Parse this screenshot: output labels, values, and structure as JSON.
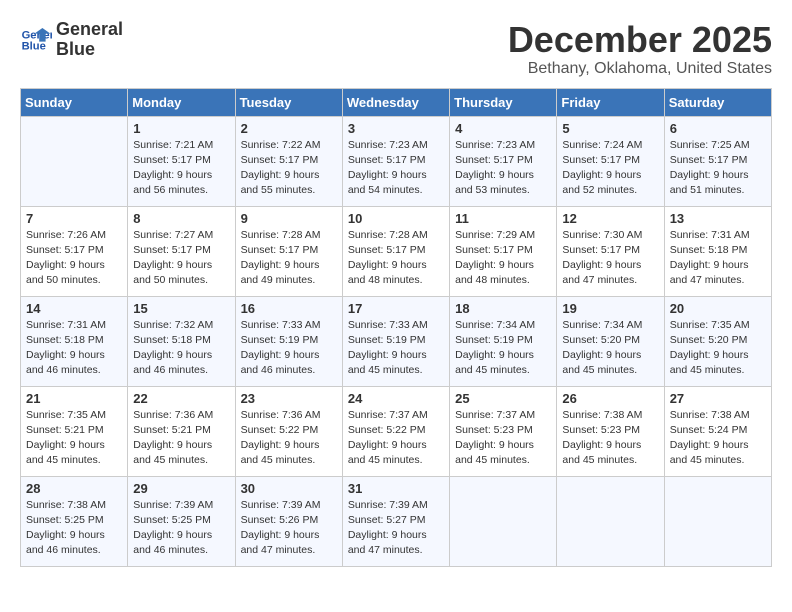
{
  "logo": {
    "line1": "General",
    "line2": "Blue"
  },
  "title": "December 2025",
  "location": "Bethany, Oklahoma, United States",
  "days_of_week": [
    "Sunday",
    "Monday",
    "Tuesday",
    "Wednesday",
    "Thursday",
    "Friday",
    "Saturday"
  ],
  "weeks": [
    [
      {
        "day": "",
        "info": ""
      },
      {
        "day": "1",
        "info": "Sunrise: 7:21 AM\nSunset: 5:17 PM\nDaylight: 9 hours\nand 56 minutes."
      },
      {
        "day": "2",
        "info": "Sunrise: 7:22 AM\nSunset: 5:17 PM\nDaylight: 9 hours\nand 55 minutes."
      },
      {
        "day": "3",
        "info": "Sunrise: 7:23 AM\nSunset: 5:17 PM\nDaylight: 9 hours\nand 54 minutes."
      },
      {
        "day": "4",
        "info": "Sunrise: 7:23 AM\nSunset: 5:17 PM\nDaylight: 9 hours\nand 53 minutes."
      },
      {
        "day": "5",
        "info": "Sunrise: 7:24 AM\nSunset: 5:17 PM\nDaylight: 9 hours\nand 52 minutes."
      },
      {
        "day": "6",
        "info": "Sunrise: 7:25 AM\nSunset: 5:17 PM\nDaylight: 9 hours\nand 51 minutes."
      }
    ],
    [
      {
        "day": "7",
        "info": "Sunrise: 7:26 AM\nSunset: 5:17 PM\nDaylight: 9 hours\nand 50 minutes."
      },
      {
        "day": "8",
        "info": "Sunrise: 7:27 AM\nSunset: 5:17 PM\nDaylight: 9 hours\nand 50 minutes."
      },
      {
        "day": "9",
        "info": "Sunrise: 7:28 AM\nSunset: 5:17 PM\nDaylight: 9 hours\nand 49 minutes."
      },
      {
        "day": "10",
        "info": "Sunrise: 7:28 AM\nSunset: 5:17 PM\nDaylight: 9 hours\nand 48 minutes."
      },
      {
        "day": "11",
        "info": "Sunrise: 7:29 AM\nSunset: 5:17 PM\nDaylight: 9 hours\nand 48 minutes."
      },
      {
        "day": "12",
        "info": "Sunrise: 7:30 AM\nSunset: 5:17 PM\nDaylight: 9 hours\nand 47 minutes."
      },
      {
        "day": "13",
        "info": "Sunrise: 7:31 AM\nSunset: 5:18 PM\nDaylight: 9 hours\nand 47 minutes."
      }
    ],
    [
      {
        "day": "14",
        "info": "Sunrise: 7:31 AM\nSunset: 5:18 PM\nDaylight: 9 hours\nand 46 minutes."
      },
      {
        "day": "15",
        "info": "Sunrise: 7:32 AM\nSunset: 5:18 PM\nDaylight: 9 hours\nand 46 minutes."
      },
      {
        "day": "16",
        "info": "Sunrise: 7:33 AM\nSunset: 5:19 PM\nDaylight: 9 hours\nand 46 minutes."
      },
      {
        "day": "17",
        "info": "Sunrise: 7:33 AM\nSunset: 5:19 PM\nDaylight: 9 hours\nand 45 minutes."
      },
      {
        "day": "18",
        "info": "Sunrise: 7:34 AM\nSunset: 5:19 PM\nDaylight: 9 hours\nand 45 minutes."
      },
      {
        "day": "19",
        "info": "Sunrise: 7:34 AM\nSunset: 5:20 PM\nDaylight: 9 hours\nand 45 minutes."
      },
      {
        "day": "20",
        "info": "Sunrise: 7:35 AM\nSunset: 5:20 PM\nDaylight: 9 hours\nand 45 minutes."
      }
    ],
    [
      {
        "day": "21",
        "info": "Sunrise: 7:35 AM\nSunset: 5:21 PM\nDaylight: 9 hours\nand 45 minutes."
      },
      {
        "day": "22",
        "info": "Sunrise: 7:36 AM\nSunset: 5:21 PM\nDaylight: 9 hours\nand 45 minutes."
      },
      {
        "day": "23",
        "info": "Sunrise: 7:36 AM\nSunset: 5:22 PM\nDaylight: 9 hours\nand 45 minutes."
      },
      {
        "day": "24",
        "info": "Sunrise: 7:37 AM\nSunset: 5:22 PM\nDaylight: 9 hours\nand 45 minutes."
      },
      {
        "day": "25",
        "info": "Sunrise: 7:37 AM\nSunset: 5:23 PM\nDaylight: 9 hours\nand 45 minutes."
      },
      {
        "day": "26",
        "info": "Sunrise: 7:38 AM\nSunset: 5:23 PM\nDaylight: 9 hours\nand 45 minutes."
      },
      {
        "day": "27",
        "info": "Sunrise: 7:38 AM\nSunset: 5:24 PM\nDaylight: 9 hours\nand 45 minutes."
      }
    ],
    [
      {
        "day": "28",
        "info": "Sunrise: 7:38 AM\nSunset: 5:25 PM\nDaylight: 9 hours\nand 46 minutes."
      },
      {
        "day": "29",
        "info": "Sunrise: 7:39 AM\nSunset: 5:25 PM\nDaylight: 9 hours\nand 46 minutes."
      },
      {
        "day": "30",
        "info": "Sunrise: 7:39 AM\nSunset: 5:26 PM\nDaylight: 9 hours\nand 47 minutes."
      },
      {
        "day": "31",
        "info": "Sunrise: 7:39 AM\nSunset: 5:27 PM\nDaylight: 9 hours\nand 47 minutes."
      },
      {
        "day": "",
        "info": ""
      },
      {
        "day": "",
        "info": ""
      },
      {
        "day": "",
        "info": ""
      }
    ]
  ]
}
